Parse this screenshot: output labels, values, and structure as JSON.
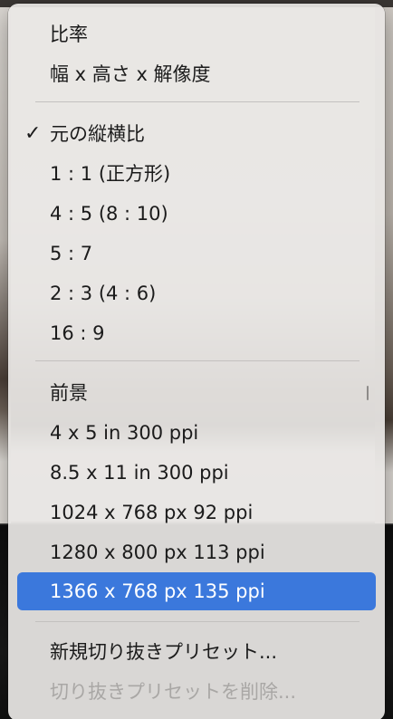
{
  "menu": {
    "items": [
      {
        "label": "比率"
      },
      {
        "label": "幅 x 高さ x 解像度"
      },
      {
        "label": "元の縦横比",
        "checked": true
      },
      {
        "label": "1 : 1 (正方形)"
      },
      {
        "label": "4 : 5 (8 : 10)"
      },
      {
        "label": "5 : 7"
      },
      {
        "label": "2 : 3 (4 : 6)"
      },
      {
        "label": "16 : 9"
      },
      {
        "label": "前景"
      },
      {
        "label": "4 x 5 in 300 ppi"
      },
      {
        "label": "8.5 x 11 in 300 ppi"
      },
      {
        "label": "1024 x 768 px 92 ppi"
      },
      {
        "label": "1280 x 800 px 113 ppi"
      },
      {
        "label": "1366 x 768 px 135 ppi",
        "highlighted": true
      },
      {
        "label": "新規切り抜きプリセット..."
      },
      {
        "label": "切り抜きプリセットを削除...",
        "disabled": true
      }
    ],
    "check_glyph": "✓",
    "highlight_color": "#3b78dc"
  }
}
